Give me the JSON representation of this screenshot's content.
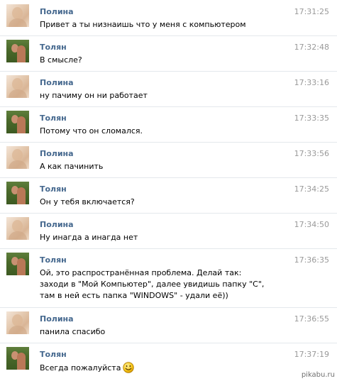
{
  "messages": [
    {
      "author": "Полина",
      "avatar": "polina-avatar",
      "time": "17:31:25",
      "text": "Привет а ты низнаишь что у меня с компьютером"
    },
    {
      "author": "Толян",
      "avatar": "tolyan-avatar",
      "time": "17:32:48",
      "text": "В смысле?"
    },
    {
      "author": "Полина",
      "avatar": "polina-avatar",
      "time": "17:33:16",
      "text": "ну пачиму он ни работает"
    },
    {
      "author": "Толян",
      "avatar": "tolyan-avatar",
      "time": "17:33:35",
      "text": "Потому что он сломался."
    },
    {
      "author": "Полина",
      "avatar": "polina-avatar",
      "time": "17:33:56",
      "text": "А как пачинить"
    },
    {
      "author": "Толян",
      "avatar": "tolyan-avatar",
      "time": "17:34:25",
      "text": "Он у тебя включается?"
    },
    {
      "author": "Полина",
      "avatar": "polina-avatar",
      "time": "17:34:50",
      "text": "Ну инагда а инагда нет"
    },
    {
      "author": "Толян",
      "avatar": "tolyan-avatar",
      "time": "17:36:35",
      "text": "Ой, это распространённая проблема. Делай так: заходи в \"Мой Компьютер\", далее увидишь папку \"C\", там в ней есть папка \"WINDOWS\" - удали её))"
    },
    {
      "author": "Полина",
      "avatar": "polina-avatar",
      "time": "17:36:55",
      "text": "панила спасибо"
    },
    {
      "author": "Толян",
      "avatar": "tolyan-avatar",
      "time": "17:37:19",
      "text": "Всегда пожалуйста",
      "emoji": "smile-emoji-icon"
    }
  ],
  "watermark": "pikabu.ru",
  "colors": {
    "author": "#45688e",
    "time": "#999999",
    "text": "#000000",
    "divider": "#e4e8ec"
  }
}
